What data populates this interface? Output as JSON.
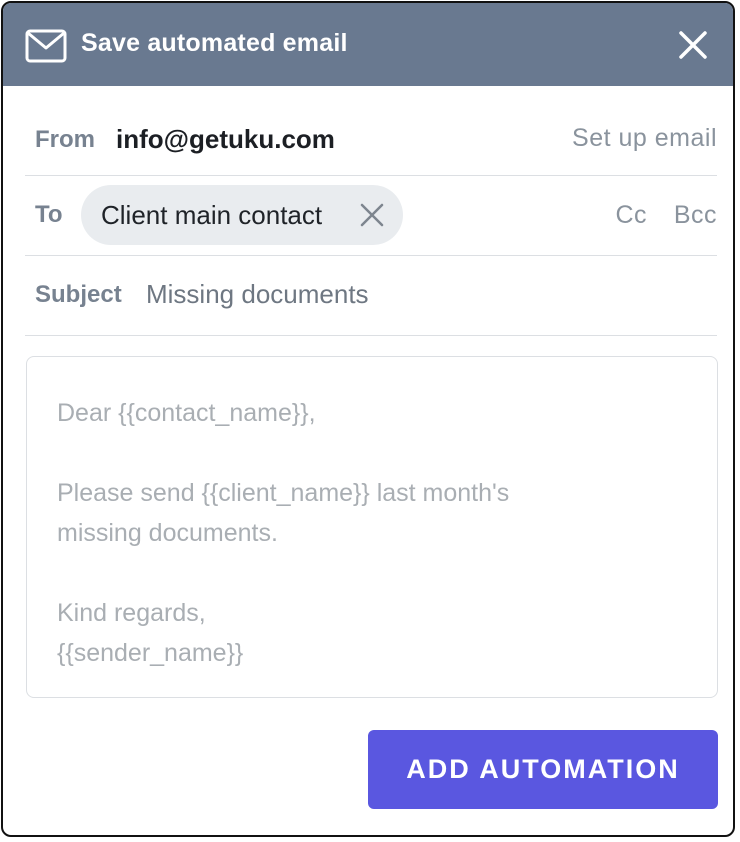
{
  "header": {
    "title": "Save automated email",
    "icon": "mail-icon",
    "close_icon": "close-icon"
  },
  "from": {
    "label": "From",
    "value": "info@getuku.com",
    "setup_link": "Set up email"
  },
  "to": {
    "label": "To",
    "chip_label": "Client main contact",
    "cc_label": "Cc",
    "bcc_label": "Bcc"
  },
  "subject": {
    "label": "Subject",
    "value": "Missing documents"
  },
  "body": {
    "lines": [
      "Dear {{contact_name}},",
      "",
      "Please send {{client_name}} last month's",
      "missing documents.",
      "",
      "Kind regards,",
      "{{sender_name}}"
    ]
  },
  "actions": {
    "add_label": "ADD AUTOMATION"
  },
  "colors": {
    "header_bg": "#697990",
    "primary_button": "#5a57e0"
  }
}
